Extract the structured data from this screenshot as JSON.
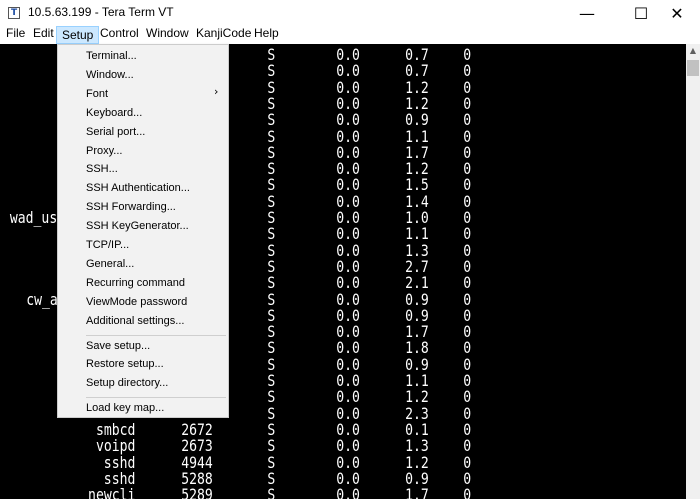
{
  "window": {
    "title": "10.5.63.199 - Tera Term VT",
    "app_icon_glyph": "T",
    "minimize": "—",
    "maximize": "☐",
    "close": "✕"
  },
  "menubar": [
    "File",
    "Edit",
    "Setup",
    "Control",
    "Window",
    "KanjiCode",
    "Help"
  ],
  "setup_menu": {
    "groups": [
      [
        "Terminal...",
        "Window...",
        "Font",
        "Keyboard...",
        "Serial port...",
        "Proxy...",
        "SSH...",
        "SSH Authentication...",
        "SSH Forwarding...",
        "SSH KeyGenerator...",
        "TCP/IP...",
        "General...",
        "Recurring command",
        "ViewMode password",
        "Additional settings..."
      ],
      [
        "Save setup...",
        "Restore setup...",
        "Setup directory..."
      ],
      [
        "Load key map..."
      ]
    ],
    "submenu_arrow": "›"
  },
  "terminal": {
    "rows": [
      [
        "",
        "",
        "S",
        "0.0",
        "0.7",
        "0"
      ],
      [
        "",
        "",
        "S",
        "0.0",
        "0.7",
        "0"
      ],
      [
        "",
        "",
        "S",
        "0.0",
        "1.2",
        "0"
      ],
      [
        "",
        "",
        "S",
        "0.0",
        "1.2",
        "0"
      ],
      [
        "",
        "",
        "S",
        "0.0",
        "0.9",
        "0"
      ],
      [
        "",
        "",
        "S",
        "0.0",
        "1.1",
        "0"
      ],
      [
        "",
        "",
        "S",
        "0.0",
        "1.7",
        "0"
      ],
      [
        "",
        "",
        "S",
        "0.0",
        "1.2",
        "0"
      ],
      [
        "",
        "",
        "S",
        "0.0",
        "1.5",
        "0"
      ],
      [
        "",
        "",
        "S",
        "0.0",
        "1.4",
        "0"
      ],
      [
        "wad_us",
        "",
        "S",
        "0.0",
        "1.0",
        "0"
      ],
      [
        "",
        "",
        "S",
        "0.0",
        "1.1",
        "0"
      ],
      [
        "",
        "",
        "S",
        "0.0",
        "1.3",
        "0"
      ],
      [
        "",
        "",
        "S",
        "0.0",
        "2.7",
        "0"
      ],
      [
        "",
        "",
        "S",
        "0.0",
        "2.1",
        "0"
      ],
      [
        "cw_a",
        "",
        "S",
        "0.0",
        "0.9",
        "0"
      ],
      [
        "",
        "",
        "S",
        "0.0",
        "0.9",
        "0"
      ],
      [
        "",
        "",
        "S",
        "0.0",
        "1.7",
        "0"
      ],
      [
        "",
        "",
        "S",
        "0.0",
        "1.8",
        "0"
      ],
      [
        "",
        "",
        "S",
        "0.0",
        "0.9",
        "0"
      ],
      [
        "",
        "",
        "S",
        "0.0",
        "1.1",
        "0"
      ],
      [
        "",
        "",
        "S",
        "0.0",
        "1.2",
        "0"
      ],
      [
        "",
        "",
        "S",
        "0.0",
        "2.3",
        "0"
      ],
      [
        "smbcd",
        "2672",
        "S",
        "0.0",
        "0.1",
        "0"
      ],
      [
        "voipd",
        "2673",
        "S",
        "0.0",
        "1.3",
        "0"
      ],
      [
        "sshd",
        "4944",
        "S",
        "0.0",
        "1.2",
        "0"
      ],
      [
        "sshd",
        "5288",
        "S",
        "0.0",
        "0.9",
        "0"
      ],
      [
        "newcli",
        "5289",
        "S",
        "0.0",
        "1.7",
        "0"
      ]
    ]
  }
}
